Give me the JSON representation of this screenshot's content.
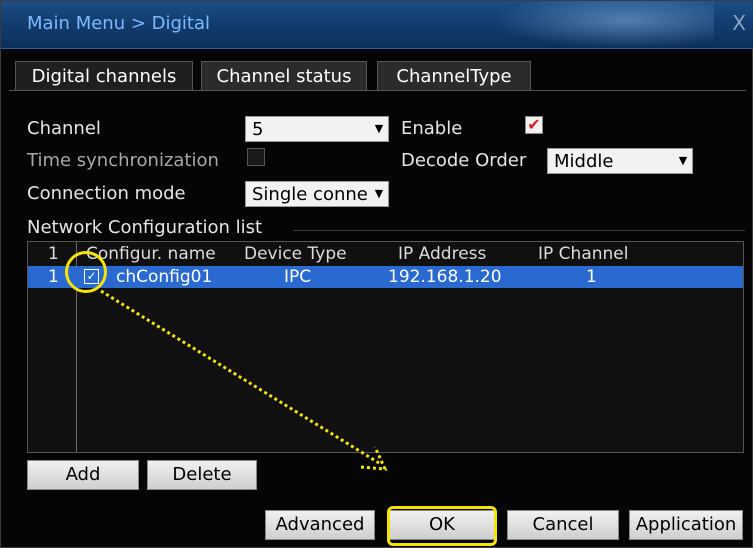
{
  "window": {
    "title": "Main Menu > Digital",
    "close_glyph": "X"
  },
  "tabs": [
    {
      "label": "Digital channels",
      "active": true
    },
    {
      "label": "Channel status",
      "active": false
    },
    {
      "label": "ChannelType",
      "active": false
    }
  ],
  "form": {
    "channel_label": "Channel",
    "channel_value": "5",
    "enable_label": "Enable",
    "enable_checked": true,
    "time_sync_label": "Time synchronization",
    "time_sync_checked": false,
    "decode_order_label": "Decode Order",
    "decode_order_value": "Middle",
    "connection_mode_label": "Connection mode",
    "connection_mode_value": "Single conne",
    "network_list_label": "Network Configuration list"
  },
  "table": {
    "headers": {
      "index": "1",
      "name": "Configur. name",
      "device_type": "Device Type",
      "ip_address": "IP Address",
      "ip_channel": "IP Channel"
    },
    "rows": [
      {
        "index": "1",
        "checked": true,
        "name": "chConfig01",
        "device_type": "IPC",
        "ip_address": "192.168.1.20",
        "ip_channel": "1"
      }
    ]
  },
  "buttons": {
    "add": "Add",
    "delete": "Delete",
    "advanced": "Advanced",
    "ok": "OK",
    "cancel": "Cancel",
    "application": "Application"
  },
  "glyphs": {
    "dropdown_arrow": "▼",
    "check_red": "✔",
    "check_box": "✓"
  },
  "colors": {
    "title_text": "#7fb8ff",
    "selection": "#2a6ad0",
    "highlight": "#f5e400",
    "check_red": "#e02020"
  }
}
